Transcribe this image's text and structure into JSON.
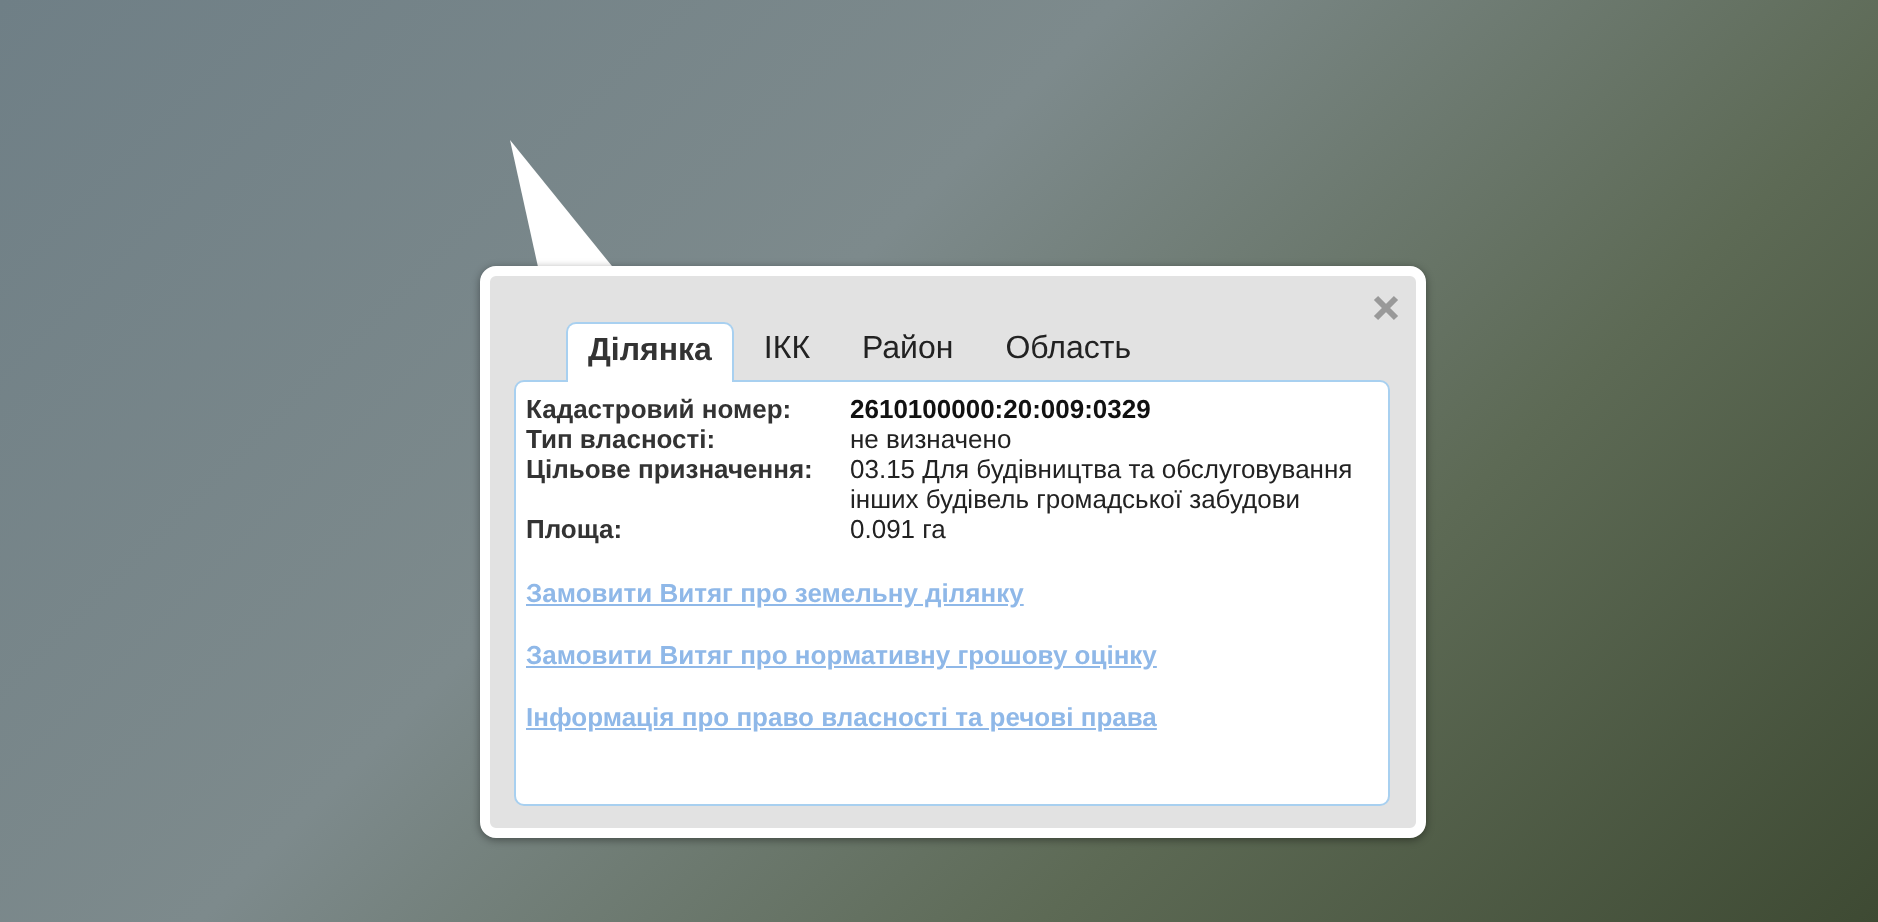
{
  "popup": {
    "tabs": [
      {
        "label": "Ділянка",
        "selected": true
      },
      {
        "label": "ІКК",
        "selected": false
      },
      {
        "label": "Район",
        "selected": false
      },
      {
        "label": "Область",
        "selected": false
      }
    ],
    "fields": [
      {
        "label": "Кадастровий номер:",
        "value": "2610100000:20:009:0329",
        "kind": "bold"
      },
      {
        "label": "Тип власності:",
        "value": "не визначено",
        "kind": "plain"
      },
      {
        "label": "Цільове призначення:",
        "value": "03.15 Для будівництва та обслуговування інших будівель громадської забудови",
        "kind": "plain"
      },
      {
        "label": "Площа:",
        "value": "0.091 га",
        "kind": "plain"
      }
    ],
    "links": [
      "Замовити Витяг про земельну ділянку",
      "Замовити Витяг про нормативну грошову оцінку",
      "Інформація про право власності та речові права"
    ]
  }
}
